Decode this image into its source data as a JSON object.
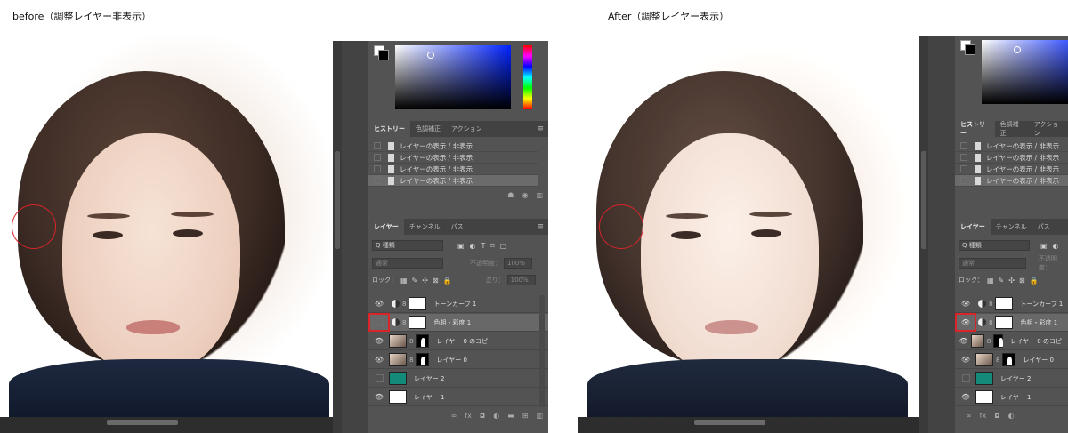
{
  "captions": {
    "before": "before（調整レイヤー非表示）",
    "after": "After（調整レイヤー表示）"
  },
  "panel": {
    "history_tabs": [
      "ヒストリー",
      "色調補正",
      "アクション"
    ],
    "history_items": [
      "レイヤーの表示 / 非表示",
      "レイヤーの表示 / 非表示",
      "レイヤーの表示 / 非表示",
      "レイヤーの表示 / 非表示"
    ],
    "layers_tabs": [
      "レイヤー",
      "チャンネル",
      "パス"
    ],
    "kind_filter": "Q 種類",
    "blend_mode": "通常",
    "opacity_label": "不透明度：",
    "opacity_value": "100%",
    "lock_label": "ロック：",
    "fill_label": "塗り：",
    "fill_value": "100%",
    "layers": [
      {
        "name": "トーンカーブ 1",
        "type": "adjustment"
      },
      {
        "name": "色相・彩度 1",
        "type": "adjustment"
      },
      {
        "name": "レイヤー 0 のコピー",
        "type": "masked"
      },
      {
        "name": "レイヤー 0",
        "type": "masked"
      },
      {
        "name": "レイヤー 2",
        "type": "fill"
      },
      {
        "name": "レイヤー 1",
        "type": "white"
      }
    ],
    "colors": {
      "panel_bg": "#535353",
      "selected": "#686868",
      "highlight": "#d9242a",
      "teal": "#138a7a"
    }
  },
  "icons": [
    "eye-icon",
    "adjustment-icon",
    "chain-icon",
    "document-icon",
    "menu-icon",
    "trash-icon",
    "camera-icon",
    "fx-icon",
    "mask-icon",
    "folder-icon",
    "new-layer-icon",
    "lock-icon"
  ],
  "before_panel": {
    "hue_layer_visible": false
  },
  "after_panel": {
    "hue_layer_visible": true
  }
}
